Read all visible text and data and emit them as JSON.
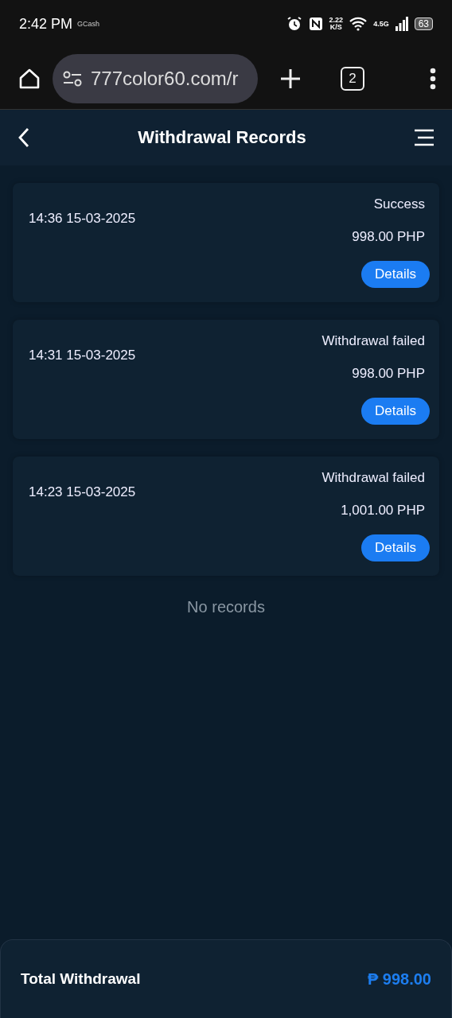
{
  "status_bar": {
    "time": "2:42 PM",
    "app_label": "GCash",
    "speed": "2.22",
    "speed_unit": "K/S",
    "network": "4.5G",
    "battery": "63"
  },
  "browser": {
    "url": "777color60.com/r",
    "tab_count": "2"
  },
  "header": {
    "title": "Withdrawal Records"
  },
  "records": [
    {
      "time": "14:36 15-03-2025",
      "status": "Success",
      "amount": "998.00 PHP",
      "button": "Details"
    },
    {
      "time": "14:31 15-03-2025",
      "status": "Withdrawal failed",
      "amount": "998.00 PHP",
      "button": "Details"
    },
    {
      "time": "14:23 15-03-2025",
      "status": "Withdrawal failed",
      "amount": "1,001.00 PHP",
      "button": "Details"
    }
  ],
  "empty_message": "No records",
  "footer": {
    "label": "Total Withdrawal",
    "total": "₱ 998.00"
  }
}
